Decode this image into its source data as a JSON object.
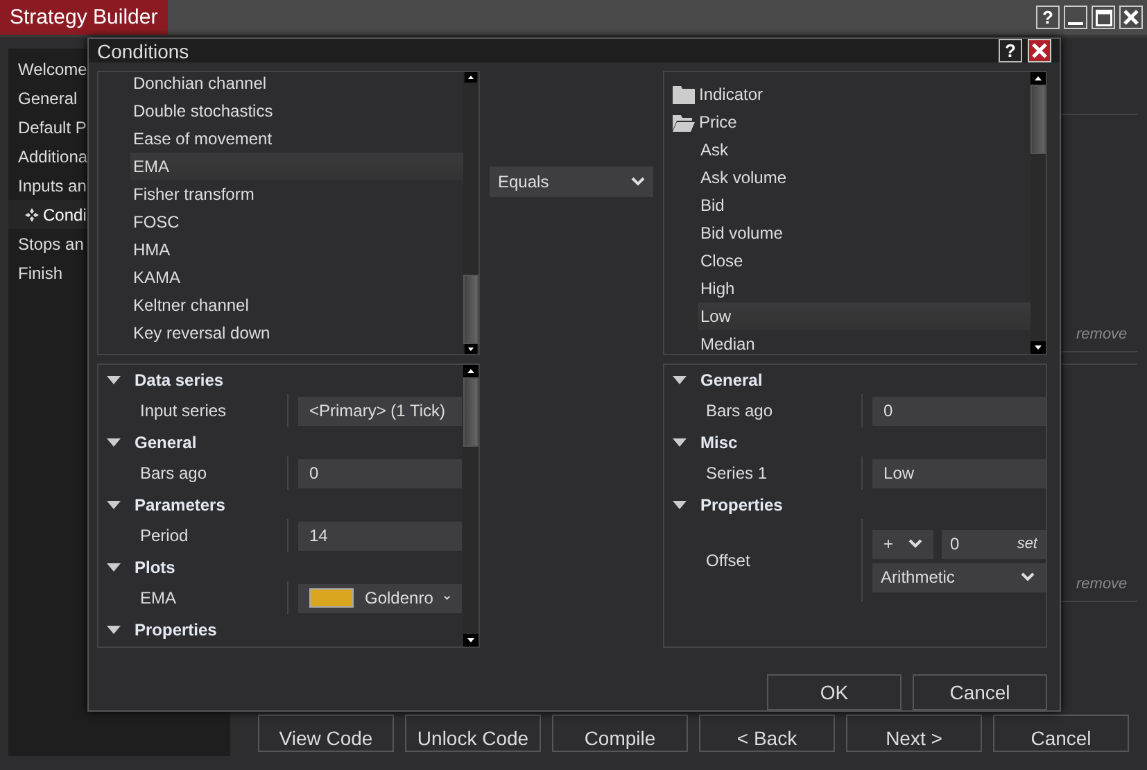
{
  "window": {
    "title": "Strategy Builder",
    "help": "?"
  },
  "sidebar": {
    "items": [
      {
        "label": "Welcome",
        "active": false
      },
      {
        "label": "General",
        "active": false
      },
      {
        "label": "Default P",
        "active": false
      },
      {
        "label": "Additiona",
        "active": false
      },
      {
        "label": "Inputs an",
        "active": false
      },
      {
        "label": "Condi",
        "active": true
      },
      {
        "label": "Stops an",
        "active": false
      },
      {
        "label": "Finish",
        "active": false
      }
    ]
  },
  "side_panels": [
    {
      "link": "remove"
    },
    {
      "link": "remove"
    }
  ],
  "bottom_buttons": [
    "View Code",
    "Unlock Code",
    "Compile",
    "< Back",
    "Next >",
    "Cancel"
  ],
  "dialog": {
    "title": "Conditions",
    "help": "?",
    "left_list": [
      {
        "label": "Donchian channel",
        "selected": false
      },
      {
        "label": "Double stochastics",
        "selected": false
      },
      {
        "label": "Ease of movement",
        "selected": false
      },
      {
        "label": "EMA",
        "selected": true
      },
      {
        "label": "Fisher transform",
        "selected": false
      },
      {
        "label": "FOSC",
        "selected": false
      },
      {
        "label": "HMA",
        "selected": false
      },
      {
        "label": "KAMA",
        "selected": false
      },
      {
        "label": "Keltner channel",
        "selected": false
      },
      {
        "label": "Key reversal down",
        "selected": false
      }
    ],
    "operator": {
      "value": "Equals"
    },
    "right_tree": [
      {
        "label": "Indicator",
        "expanded": false
      },
      {
        "label": "Price",
        "expanded": true,
        "children": [
          {
            "label": "Ask",
            "selected": false
          },
          {
            "label": "Ask volume",
            "selected": false
          },
          {
            "label": "Bid",
            "selected": false
          },
          {
            "label": "Bid volume",
            "selected": false
          },
          {
            "label": "Close",
            "selected": false
          },
          {
            "label": "High",
            "selected": false
          },
          {
            "label": "Low",
            "selected": true
          },
          {
            "label": "Median",
            "selected": false
          }
        ]
      }
    ],
    "left_props": [
      {
        "title": "Data series",
        "expanded": true,
        "rows": [
          {
            "kind": "text",
            "label": "Input series",
            "value": "<Primary> (1 Tick)"
          }
        ]
      },
      {
        "title": "General",
        "expanded": true,
        "rows": [
          {
            "kind": "text",
            "label": "Bars ago",
            "value": "0"
          }
        ]
      },
      {
        "title": "Parameters",
        "expanded": true,
        "rows": [
          {
            "kind": "text",
            "label": "Period",
            "value": "14"
          }
        ]
      },
      {
        "title": "Plots",
        "expanded": true,
        "rows": [
          {
            "kind": "color",
            "label": "EMA",
            "value": "Goldenro",
            "color": "#daa520"
          }
        ]
      },
      {
        "title": "Properties",
        "expanded": true
      }
    ],
    "right_props": [
      {
        "title": "General",
        "expanded": true,
        "rows": [
          {
            "kind": "text",
            "label": "Bars ago",
            "value": "0"
          }
        ]
      },
      {
        "title": "Misc",
        "expanded": true,
        "rows": [
          {
            "kind": "text",
            "label": "Series 1",
            "value": "Low"
          }
        ]
      },
      {
        "title": "Properties",
        "expanded": true,
        "rows": [
          {
            "kind": "offset",
            "label": "Offset",
            "sign": "+",
            "value": "0",
            "action": "set",
            "mode": "Arithmetic"
          }
        ]
      }
    ],
    "buttons": [
      "OK",
      "Cancel"
    ]
  }
}
